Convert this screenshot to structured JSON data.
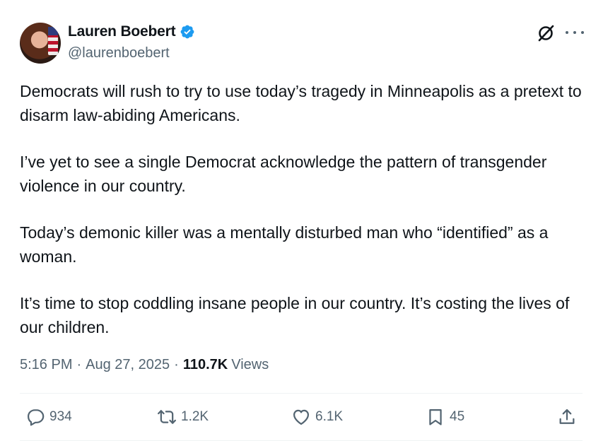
{
  "author": {
    "display_name": "Lauren Boebert",
    "handle": "@laurenboebert",
    "verified": true,
    "verified_color": "#1d9bf0"
  },
  "header_icons": [
    "grok-icon",
    "more-options-icon"
  ],
  "tweet": {
    "paragraphs": [
      "Democrats will rush to try to use today’s tragedy in Minneapolis as a pretext to disarm law-abiding Americans.",
      "I’ve yet to see a single Democrat acknowledge the pattern of transgender violence in our country.",
      "Today’s demonic killer was a mentally disturbed man who “identified” as a woman.",
      "It’s time to stop coddling insane people in our country. It’s costing the lives of our children."
    ]
  },
  "meta": {
    "time": "5:16 PM",
    "separator": "·",
    "date": "Aug 27, 2025",
    "views_count": "110.7K",
    "views_label": "Views"
  },
  "actions": {
    "replies": "934",
    "reposts": "1.2K",
    "likes": "6.1K",
    "bookmarks": "45"
  },
  "colors": {
    "text_primary": "#0f1419",
    "text_secondary": "#536471",
    "divider": "#eff3f4"
  }
}
